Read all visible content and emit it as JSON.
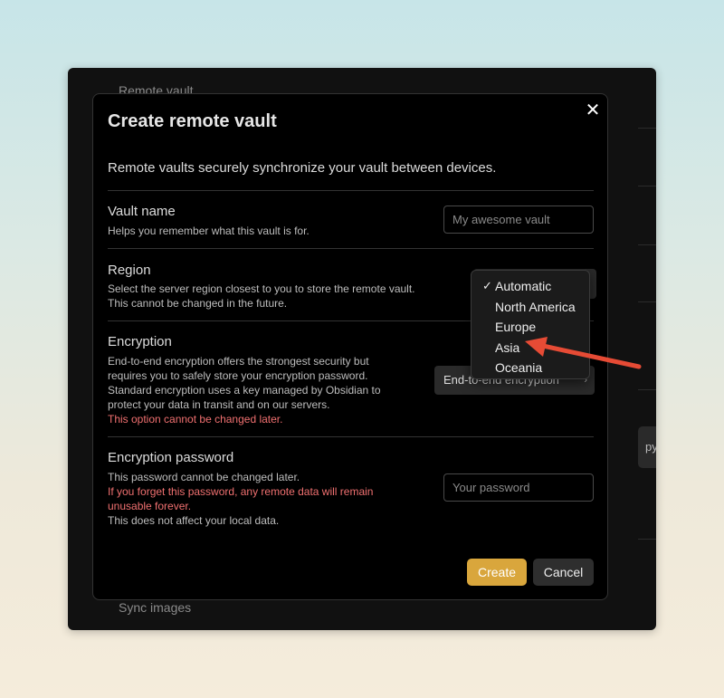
{
  "background": {
    "top_label": "Remote vault",
    "bottom_label": "Sync images",
    "right_button_fragment": "py"
  },
  "modal": {
    "title": "Create remote vault",
    "close_icon": "close-icon",
    "description": "Remote vaults securely synchronize your vault between devices."
  },
  "vault_name": {
    "name": "Vault name",
    "desc": "Helps you remember what this vault is for.",
    "placeholder": "My awesome vault"
  },
  "region": {
    "name": "Region",
    "desc_line1": "Select the server region closest to you to store the remote vault.",
    "desc_line2": "This cannot be changed in the future.",
    "options": [
      "Automatic",
      "North America",
      "Europe",
      "Asia",
      "Oceania"
    ],
    "selected": "Automatic",
    "check_icon": "checkmark-icon"
  },
  "encryption": {
    "name": "Encryption",
    "desc": "End-to-end encryption offers the strongest security but requires you to safely store your encryption password. Standard encryption uses a key managed by Obsidian to protect your data in transit and on our servers.",
    "warning": "This option cannot be changed later.",
    "value": "End-to-end encryption"
  },
  "password": {
    "name": "Encryption password",
    "desc_line1": "This password cannot be changed later.",
    "warning": "If you forget this password, any remote data will remain unusable forever.",
    "desc_line3": "This does not affect your local data.",
    "placeholder": "Your password"
  },
  "actions": {
    "create": "Create",
    "cancel": "Cancel"
  },
  "annotation": {
    "arrow_color": "#e64b35",
    "points_to": "Asia"
  },
  "colors": {
    "accent": "#d9a63c",
    "warning_text": "#f07070"
  }
}
